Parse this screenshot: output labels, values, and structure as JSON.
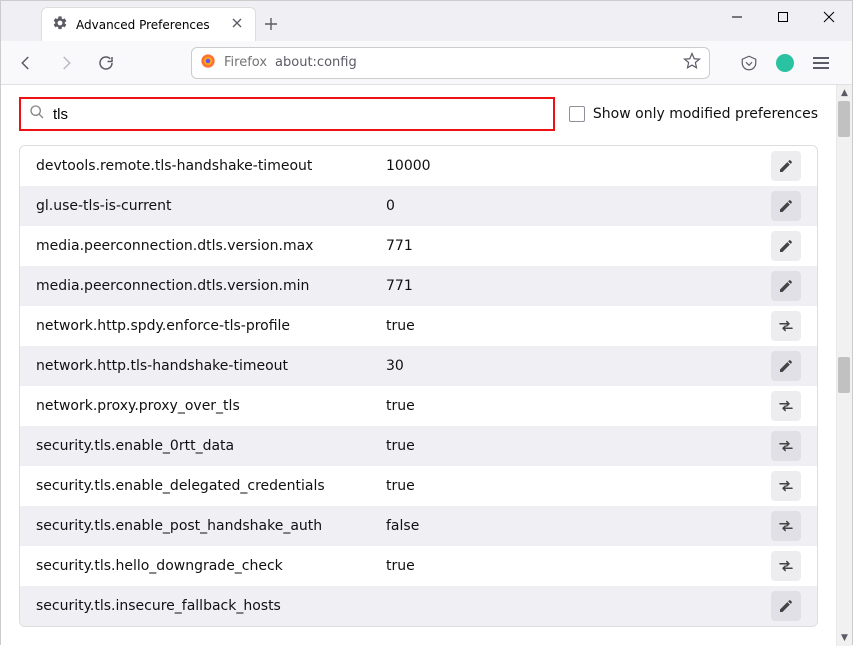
{
  "window": {
    "tab_title": "Advanced Preferences"
  },
  "toolbar": {
    "firefox_label": "Firefox",
    "url": "about:config"
  },
  "search": {
    "value": "tls",
    "show_only_label": "Show only modified preferences"
  },
  "prefs": [
    {
      "name": "devtools.remote.tls-handshake-timeout",
      "value": "10000",
      "action": "edit"
    },
    {
      "name": "gl.use-tls-is-current",
      "value": "0",
      "action": "edit"
    },
    {
      "name": "media.peerconnection.dtls.version.max",
      "value": "771",
      "action": "edit"
    },
    {
      "name": "media.peerconnection.dtls.version.min",
      "value": "771",
      "action": "edit"
    },
    {
      "name": "network.http.spdy.enforce-tls-profile",
      "value": "true",
      "action": "toggle"
    },
    {
      "name": "network.http.tls-handshake-timeout",
      "value": "30",
      "action": "edit"
    },
    {
      "name": "network.proxy.proxy_over_tls",
      "value": "true",
      "action": "toggle"
    },
    {
      "name": "security.tls.enable_0rtt_data",
      "value": "true",
      "action": "toggle"
    },
    {
      "name": "security.tls.enable_delegated_credentials",
      "value": "true",
      "action": "toggle"
    },
    {
      "name": "security.tls.enable_post_handshake_auth",
      "value": "false",
      "action": "toggle"
    },
    {
      "name": "security.tls.hello_downgrade_check",
      "value": "true",
      "action": "toggle"
    },
    {
      "name": "security.tls.insecure_fallback_hosts",
      "value": "",
      "action": "edit"
    }
  ]
}
